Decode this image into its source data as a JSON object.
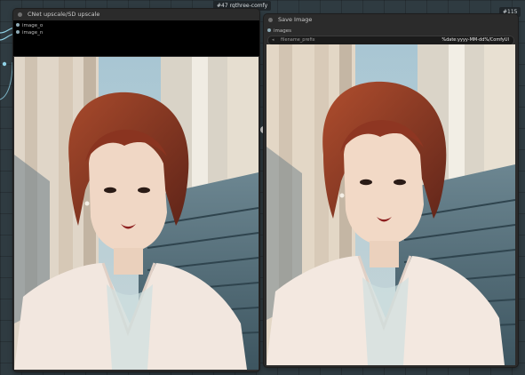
{
  "badges": {
    "left_node": "#47 rgthree-comfy",
    "right_node": "#115"
  },
  "upscale_node": {
    "title": "CNet upscale/SD upscale",
    "inputs": [
      "image_o",
      "image_n"
    ]
  },
  "save_node": {
    "title": "Save Image",
    "inputs": [
      "images"
    ],
    "widget": {
      "label": "filename_prefix",
      "value": "%date:yyyy-MM-dd%/ComfyUI"
    }
  },
  "colors": {
    "canvas": "#2f3b41",
    "node_body": "#2b2b2b",
    "wire": "#8fd1e6"
  }
}
